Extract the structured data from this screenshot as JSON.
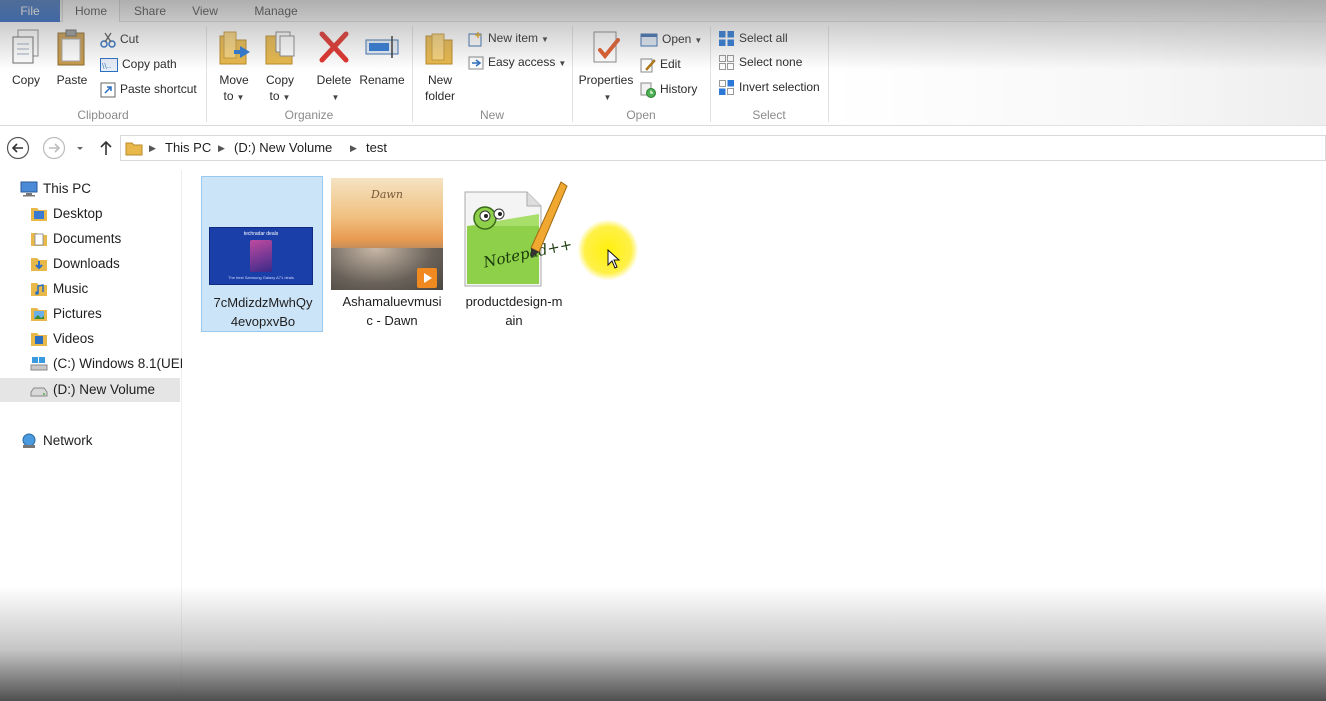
{
  "ribbon": {
    "tabs": [
      "File",
      "Home",
      "Share",
      "View",
      "Manage"
    ],
    "clipboard": {
      "copy": "Copy",
      "paste": "Paste",
      "cut": "Cut",
      "copy_path": "Copy path",
      "paste_shortcut": "Paste shortcut",
      "label": "Clipboard"
    },
    "organize": {
      "move_to_1": "Move",
      "move_to_2": "to",
      "copy_to_1": "Copy",
      "copy_to_2": "to",
      "delete": "Delete",
      "rename": "Rename",
      "label": "Organize"
    },
    "new": {
      "new_folder_1": "New",
      "new_folder_2": "folder",
      "new_item": "New item",
      "easy_access": "Easy access",
      "label": "New"
    },
    "open": {
      "properties": "Properties",
      "open": "Open",
      "edit": "Edit",
      "history": "History",
      "label": "Open"
    },
    "select": {
      "select_all": "Select all",
      "select_none": "Select none",
      "invert_selection": "Invert selection",
      "label": "Select"
    }
  },
  "address": {
    "crumbs": [
      "This PC",
      "(D:) New Volume",
      "test"
    ]
  },
  "sidebar": {
    "items": [
      {
        "label": "This PC",
        "icon": "computer-icon"
      },
      {
        "label": "Desktop",
        "icon": "desktop-folder-icon"
      },
      {
        "label": "Documents",
        "icon": "documents-folder-icon"
      },
      {
        "label": "Downloads",
        "icon": "downloads-folder-icon"
      },
      {
        "label": "Music",
        "icon": "music-folder-icon"
      },
      {
        "label": "Pictures",
        "icon": "pictures-folder-icon"
      },
      {
        "label": "Videos",
        "icon": "videos-folder-icon"
      },
      {
        "label": "(C:) Windows 8.1(UEF",
        "icon": "windows-drive-icon"
      },
      {
        "label": "(D:) New Volume",
        "icon": "drive-icon"
      },
      {
        "label": "Network",
        "icon": "network-icon"
      }
    ]
  },
  "files": [
    {
      "name": "7cMdizdzMwhQy4evopxvBo",
      "line1": "7cMdizdzMwhQy",
      "line2": "4evopxvBo",
      "thumb_brand": "techradar deals",
      "thumb_caption": "The best Samsung Galaxy A71 deals"
    },
    {
      "name": "Ashamaluevmusic - Dawn",
      "line1": "Ashamaluevmusi",
      "line2": "c - Dawn",
      "thumb_title": "Dawn"
    },
    {
      "name": "productdesign-main",
      "line1": "productdesign-m",
      "line2": "ain",
      "thumb_text": "Notepad++"
    }
  ],
  "colors": {
    "file_tab": "#1f5fbf",
    "selection_bg": "#cce4f7",
    "selection_border": "#99c9ef",
    "cursor_highlight": "#fff000"
  }
}
